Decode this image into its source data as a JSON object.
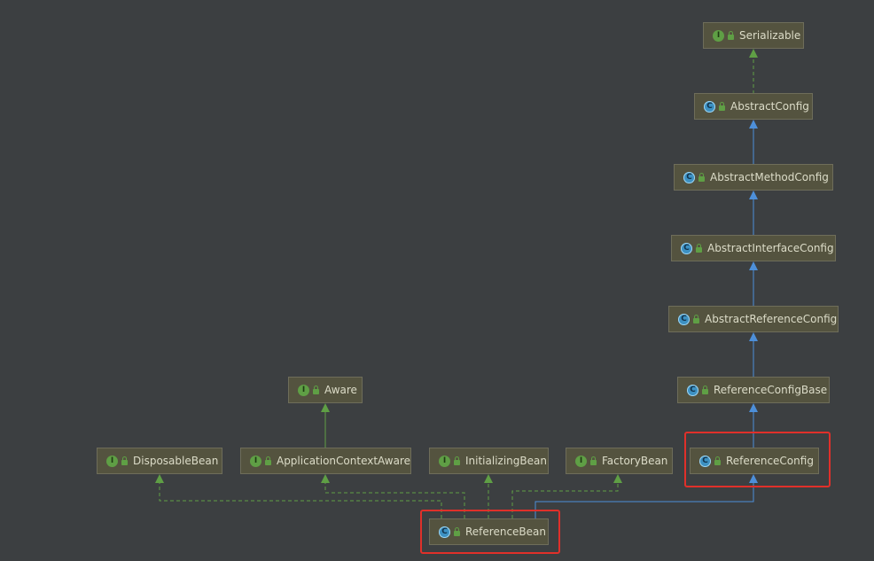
{
  "nodes": {
    "serializable": {
      "label": "Serializable",
      "kind": "I"
    },
    "abstract_config": {
      "label": "AbstractConfig",
      "kind": "C"
    },
    "abstract_method_config": {
      "label": "AbstractMethodConfig",
      "kind": "C"
    },
    "abstract_interface_config": {
      "label": "AbstractInterfaceConfig",
      "kind": "C"
    },
    "abstract_reference_config": {
      "label": "AbstractReferenceConfig",
      "kind": "C"
    },
    "reference_config_base": {
      "label": "ReferenceConfigBase",
      "kind": "C"
    },
    "reference_config": {
      "label": "ReferenceConfig",
      "kind": "C"
    },
    "aware": {
      "label": "Aware",
      "kind": "I"
    },
    "disposable_bean": {
      "label": "DisposableBean",
      "kind": "I"
    },
    "application_context_aware": {
      "label": "ApplicationContextAware",
      "kind": "I"
    },
    "initializing_bean": {
      "label": "InitializingBean",
      "kind": "I"
    },
    "factory_bean": {
      "label": "FactoryBean",
      "kind": "I"
    },
    "reference_bean": {
      "label": "ReferenceBean",
      "kind": "C"
    }
  },
  "colors": {
    "background": "#3c3f41",
    "extends_edge": "#4d8fd9",
    "implements_edge": "#5f9f45",
    "highlight": "#e0302a"
  },
  "icons": {
    "interface": "interface-badge-icon",
    "class": "class-badge-icon",
    "visibility": "lock-icon"
  }
}
